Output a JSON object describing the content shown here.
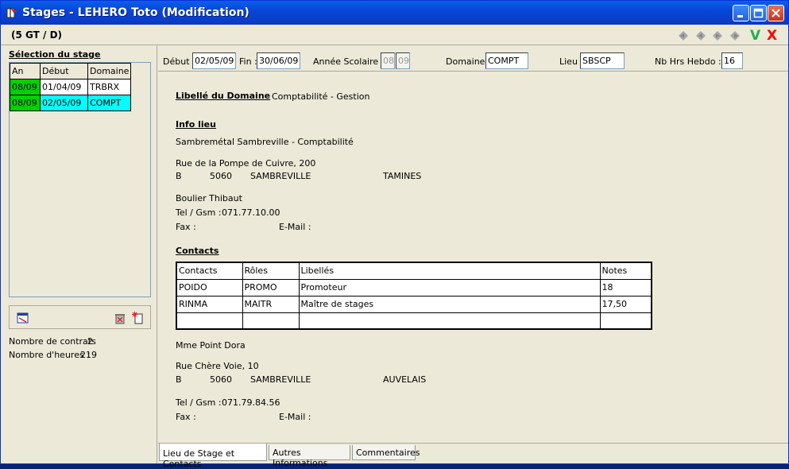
{
  "window": {
    "title": "Stages - LEHERO Toto (Modification)"
  },
  "header": {
    "class_code": "(5 GT / D)"
  },
  "colors": {
    "titlebar": "#0846d8",
    "selected_year": "#00d000",
    "selected_row": "#00ffff",
    "ok": "#22b14c",
    "cancel": "#ff0000"
  },
  "toolbar": {
    "ok": "V",
    "cancel": "X"
  },
  "left": {
    "header": "Sélection du stage",
    "columns": [
      "An",
      "Début",
      "Domaine"
    ],
    "rows": [
      {
        "an": "08/09",
        "debut": "01/04/09",
        "domaine": "TRBRX"
      },
      {
        "an": "08/09",
        "debut": "02/05/09",
        "domaine": "COMPT"
      }
    ],
    "contracts_label": "Nombre de contrats",
    "contracts_value": "2",
    "hours_label": "Nombre d'heures :",
    "hours_value": "219"
  },
  "fields": {
    "debut_label": "Début :",
    "debut": "02/05/09",
    "fin_label": "Fin :",
    "fin": "30/06/09",
    "annee_label": "Année Scolaire :",
    "annee1": "08",
    "annee2": "09",
    "domaine_label": "Domaine :",
    "domaine": "COMPT",
    "lieu_label": "Lieu :",
    "lieu": "SBSCP",
    "hrs_label": "Nb Hrs Hebdo :",
    "hrs": "16"
  },
  "content": {
    "domain_title": "Libellé du Domaine",
    "domain_value": "Comptabilité - Gestion",
    "lieu_title": "Info lieu",
    "lieu_name": "Sambremétal Sambreville - Comptabilité",
    "lieu_street": "Rue de la Pompe de Cuivre, 200",
    "lieu_country": "B",
    "lieu_zip": "5060",
    "lieu_city": "SAMBREVILLE",
    "lieu_locality": "TAMINES",
    "lieu_person": "Boulier Thibaut",
    "tel_label": "Tel / Gsm :",
    "lieu_tel": "071.77.10.00",
    "fax_label": "Fax :",
    "email_label": "E-Mail :",
    "contacts_title": "Contacts",
    "contacts_columns": [
      "Contacts",
      "Rôles",
      "Libellés",
      "Notes"
    ],
    "contacts_rows": [
      {
        "contact": "POIDO",
        "role": "PROMO",
        "libelle": "Promoteur",
        "note": "18"
      },
      {
        "contact": "RINMA",
        "role": "MAITR",
        "libelle": "Maître de stages",
        "note": "17,50"
      }
    ],
    "person2": "Mme Point Dora",
    "street2": "Rue Chère Voie, 10",
    "country2": "B",
    "zip2": "5060",
    "city2": "SAMBREVILLE",
    "locality2": "AUVELAIS",
    "tel2": "071.79.84.56"
  },
  "tabs": [
    "Lieu de Stage et Contacts",
    "Autres Informations",
    "Commentaires"
  ]
}
